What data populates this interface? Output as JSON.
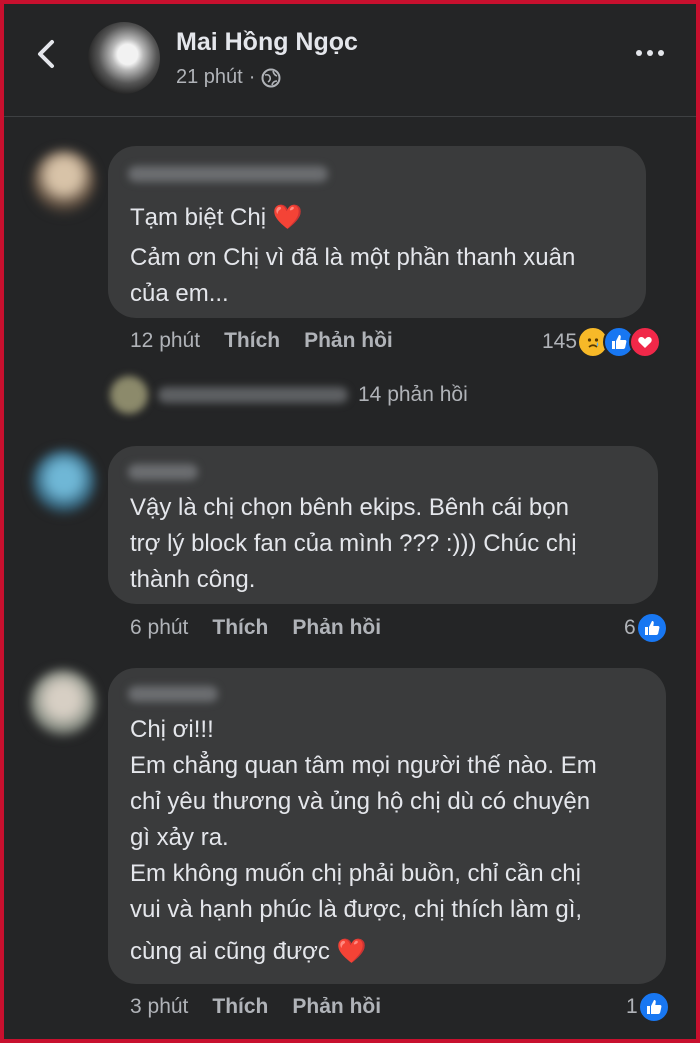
{
  "header": {
    "name": "Mai Hồng Ngọc",
    "time": "21 phút",
    "dot": "·"
  },
  "comments": [
    {
      "lines": [
        "Tạm biệt Chị",
        "Cảm ơn Chị vì đã là một phần thanh xuân",
        "của em..."
      ],
      "time": "12 phút",
      "like_label": "Thích",
      "reply_label": "Phản hồi",
      "reaction_count": "145",
      "replies_count": "14 phản hồi"
    },
    {
      "lines": [
        "Vậy là chị chọn bênh ekips. Bênh cái bọn",
        "trợ lý block fan của mình ???   :))) Chúc chị",
        "thành công."
      ],
      "time": "6 phút",
      "like_label": "Thích",
      "reply_label": "Phản hồi",
      "reaction_count": "6"
    },
    {
      "lines": [
        "Chị ơi!!!",
        "Em chẳng quan tâm mọi người thế nào. Em",
        "chỉ yêu thương và ủng hộ chị dù có chuyện",
        "gì xảy ra.",
        "Em không muốn chị phải buồn, chỉ cần chị",
        "vui và hạnh phúc là được, chị thích làm gì,",
        "cùng ai cũng được"
      ],
      "time": "3 phút",
      "like_label": "Thích",
      "reply_label": "Phản hồi",
      "reaction_count": "1"
    }
  ],
  "colors": {
    "background": "#242526",
    "bubble": "#3a3b3c",
    "like_blue": "#1877f2",
    "heart_red": "#f02849",
    "border": "#c8102e"
  },
  "icons": [
    "back-arrow-icon",
    "globe-icon",
    "more-dots-icon",
    "heart-emoji-icon",
    "sad-emoji-icon",
    "like-icon",
    "love-icon"
  ]
}
